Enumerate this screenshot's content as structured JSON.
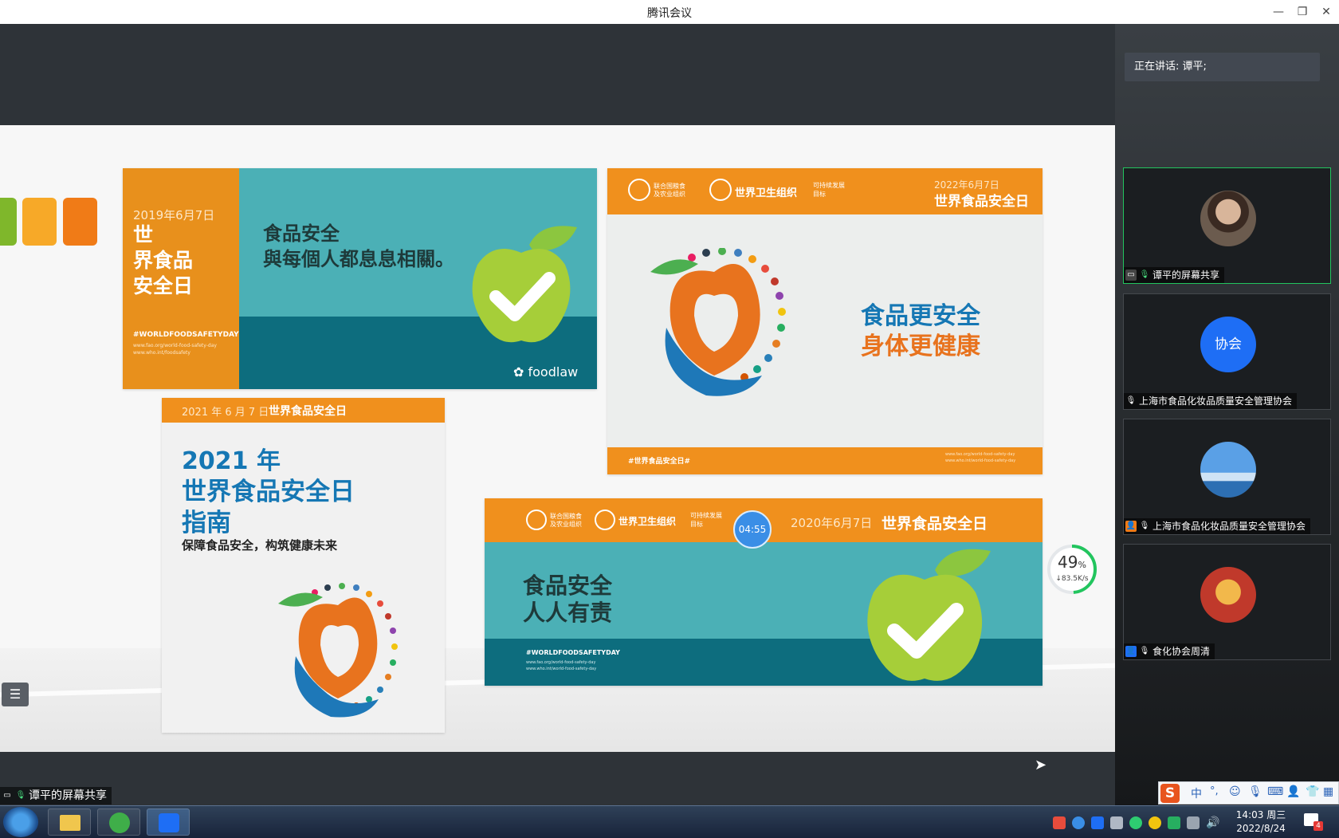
{
  "window": {
    "title": "腾讯会议",
    "minimize": "—",
    "restore": "❐",
    "close": "✕"
  },
  "slide": {
    "p1": {
      "date": "2019年6月7日",
      "side_title": [
        "世",
        "界食品",
        "安全日"
      ],
      "hashtag": "#WORLDFOODSAFETYDAY",
      "url1": "www.fao.org/world-food-safety-day",
      "url2": "www.who.int/foodsafety",
      "main_line1": "食品安全",
      "main_line2": "與每個人都息息相關。",
      "brand": "foodlaw"
    },
    "p2": {
      "org_fao": "联合国粮食及农业组织",
      "org_who": "世界卫生组织",
      "org_sdg": "可持续发展目标",
      "date": "2022年6月7日",
      "title": "世界食品安全日",
      "line1": "食品更安全",
      "line2": "身体更健康",
      "hashtag": "#世界食品安全日#",
      "url1": "www.fao.org/world-food-safety-day",
      "url2": "www.who.int/world-food-safety-day"
    },
    "p3": {
      "header_date": "2021 年 6 月 7 日",
      "header_title": "世界食品安全日",
      "year": "2021 年",
      "title1": "世界食品安全日",
      "title2": "指南",
      "subtitle": "保障食品安全，构筑健康未来"
    },
    "p4": {
      "org_fao": "联合国粮食及农业组织",
      "org_who": "世界卫生组织",
      "org_sdg": "可持续发展目标",
      "date": "2020年6月7日",
      "title": "世界食品安全日",
      "line1": "食品安全",
      "line2": "人人有责",
      "hashtag": "#WORLDFOODSAFETYDAY",
      "url1": "www.fao.org/world-food-safety-day",
      "url2": "www.who.int/world-food-safety-day"
    }
  },
  "timer": "04:55",
  "network": {
    "percent": "49",
    "percent_unit": "%",
    "speed": "↓83.5K/s"
  },
  "sidebar": {
    "speaking": "正在讲话: 谭平;",
    "tiles": [
      {
        "label": "谭平的屏幕共享"
      },
      {
        "avatar_text": "协会",
        "label": "上海市食品化妆品质量安全管理协会"
      },
      {
        "label": "上海市食品化妆品质量安全管理协会"
      },
      {
        "label": "食化协会周清"
      }
    ]
  },
  "share_caption": "谭平的屏幕共享",
  "ime": {
    "mode": "中",
    "punct": "°,"
  },
  "clock": {
    "time": "14:03 周三",
    "date": "2022/8/24"
  },
  "notify_count": "4",
  "colors": {
    "orange": "#f0901d",
    "teal": "#4bb0b6",
    "dark_teal": "#0d6d7e",
    "blue_text": "#1577b4",
    "active_border": "#22c55e"
  }
}
